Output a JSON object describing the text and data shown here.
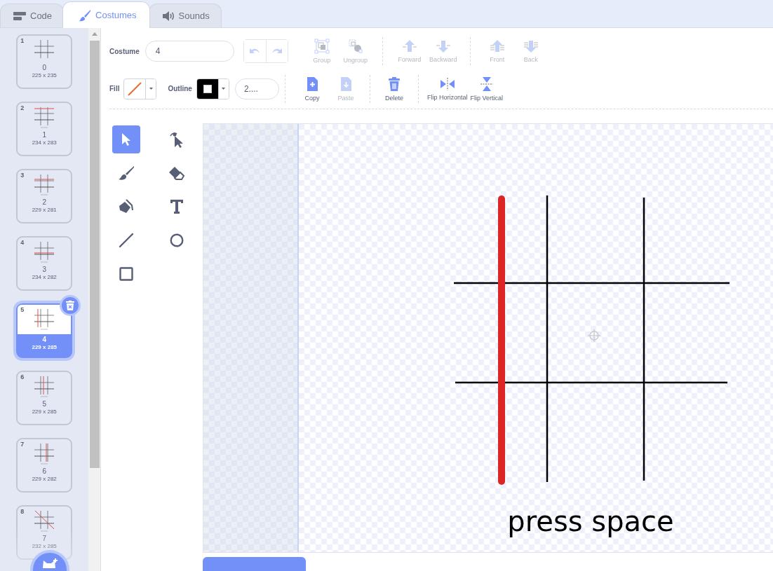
{
  "tabs": [
    {
      "label": "Code",
      "kind": "code",
      "selected": false
    },
    {
      "label": "Costumes",
      "kind": "costumes",
      "selected": true
    },
    {
      "label": "Sounds",
      "kind": "sounds",
      "selected": false
    }
  ],
  "costumes": [
    {
      "number": "1",
      "name": "0",
      "size": "225 x 235",
      "selected": false
    },
    {
      "number": "2",
      "name": "1",
      "size": "234 x 283",
      "selected": false
    },
    {
      "number": "3",
      "name": "2",
      "size": "229 x 281",
      "selected": false
    },
    {
      "number": "4",
      "name": "3",
      "size": "234 x 282",
      "selected": false
    },
    {
      "number": "5",
      "name": "4",
      "size": "229 x 285",
      "selected": true
    },
    {
      "number": "6",
      "name": "5",
      "size": "229 x 285",
      "selected": false
    },
    {
      "number": "7",
      "name": "6",
      "size": "229 x 282",
      "selected": false
    },
    {
      "number": "8",
      "name": "7",
      "size": "232 x 285",
      "selected": false
    }
  ],
  "costume_name": {
    "label": "Costume",
    "value": "4"
  },
  "undo": {
    "disabled": true
  },
  "redo": {
    "disabled": true
  },
  "arrange_tools": [
    {
      "label": "Group",
      "kind": "group",
      "disabled": true
    },
    {
      "label": "Ungroup",
      "kind": "ungroup",
      "disabled": true
    },
    {
      "label": "Forward",
      "kind": "forward",
      "disabled": true
    },
    {
      "label": "Backward",
      "kind": "backward",
      "disabled": true
    },
    {
      "label": "Front",
      "kind": "front",
      "disabled": true
    },
    {
      "label": "Back",
      "kind": "back",
      "disabled": true
    }
  ],
  "fill": {
    "label": "Fill"
  },
  "outline": {
    "label": "Outline"
  },
  "stroke_width": {
    "value": "2...."
  },
  "edit_tools": [
    {
      "label": "Copy",
      "kind": "copy",
      "disabled": false
    },
    {
      "label": "Paste",
      "kind": "paste",
      "disabled": true
    },
    {
      "label": "Delete",
      "kind": "delete",
      "disabled": false
    },
    {
      "label": "Flip Horizontal",
      "kind": "flip-h",
      "disabled": false
    },
    {
      "label": "Flip Vertical",
      "kind": "flip-v",
      "disabled": false
    }
  ],
  "tools": [
    {
      "kind": "select",
      "selected": true
    },
    {
      "kind": "reshape",
      "selected": false
    },
    {
      "kind": "brush",
      "selected": false
    },
    {
      "kind": "eraser",
      "selected": false
    },
    {
      "kind": "fill",
      "selected": false
    },
    {
      "kind": "text",
      "selected": false
    },
    {
      "kind": "line",
      "selected": false
    },
    {
      "kind": "circle",
      "selected": false
    },
    {
      "kind": "rectangle",
      "selected": false
    }
  ],
  "canvas": {
    "text": "press space"
  }
}
